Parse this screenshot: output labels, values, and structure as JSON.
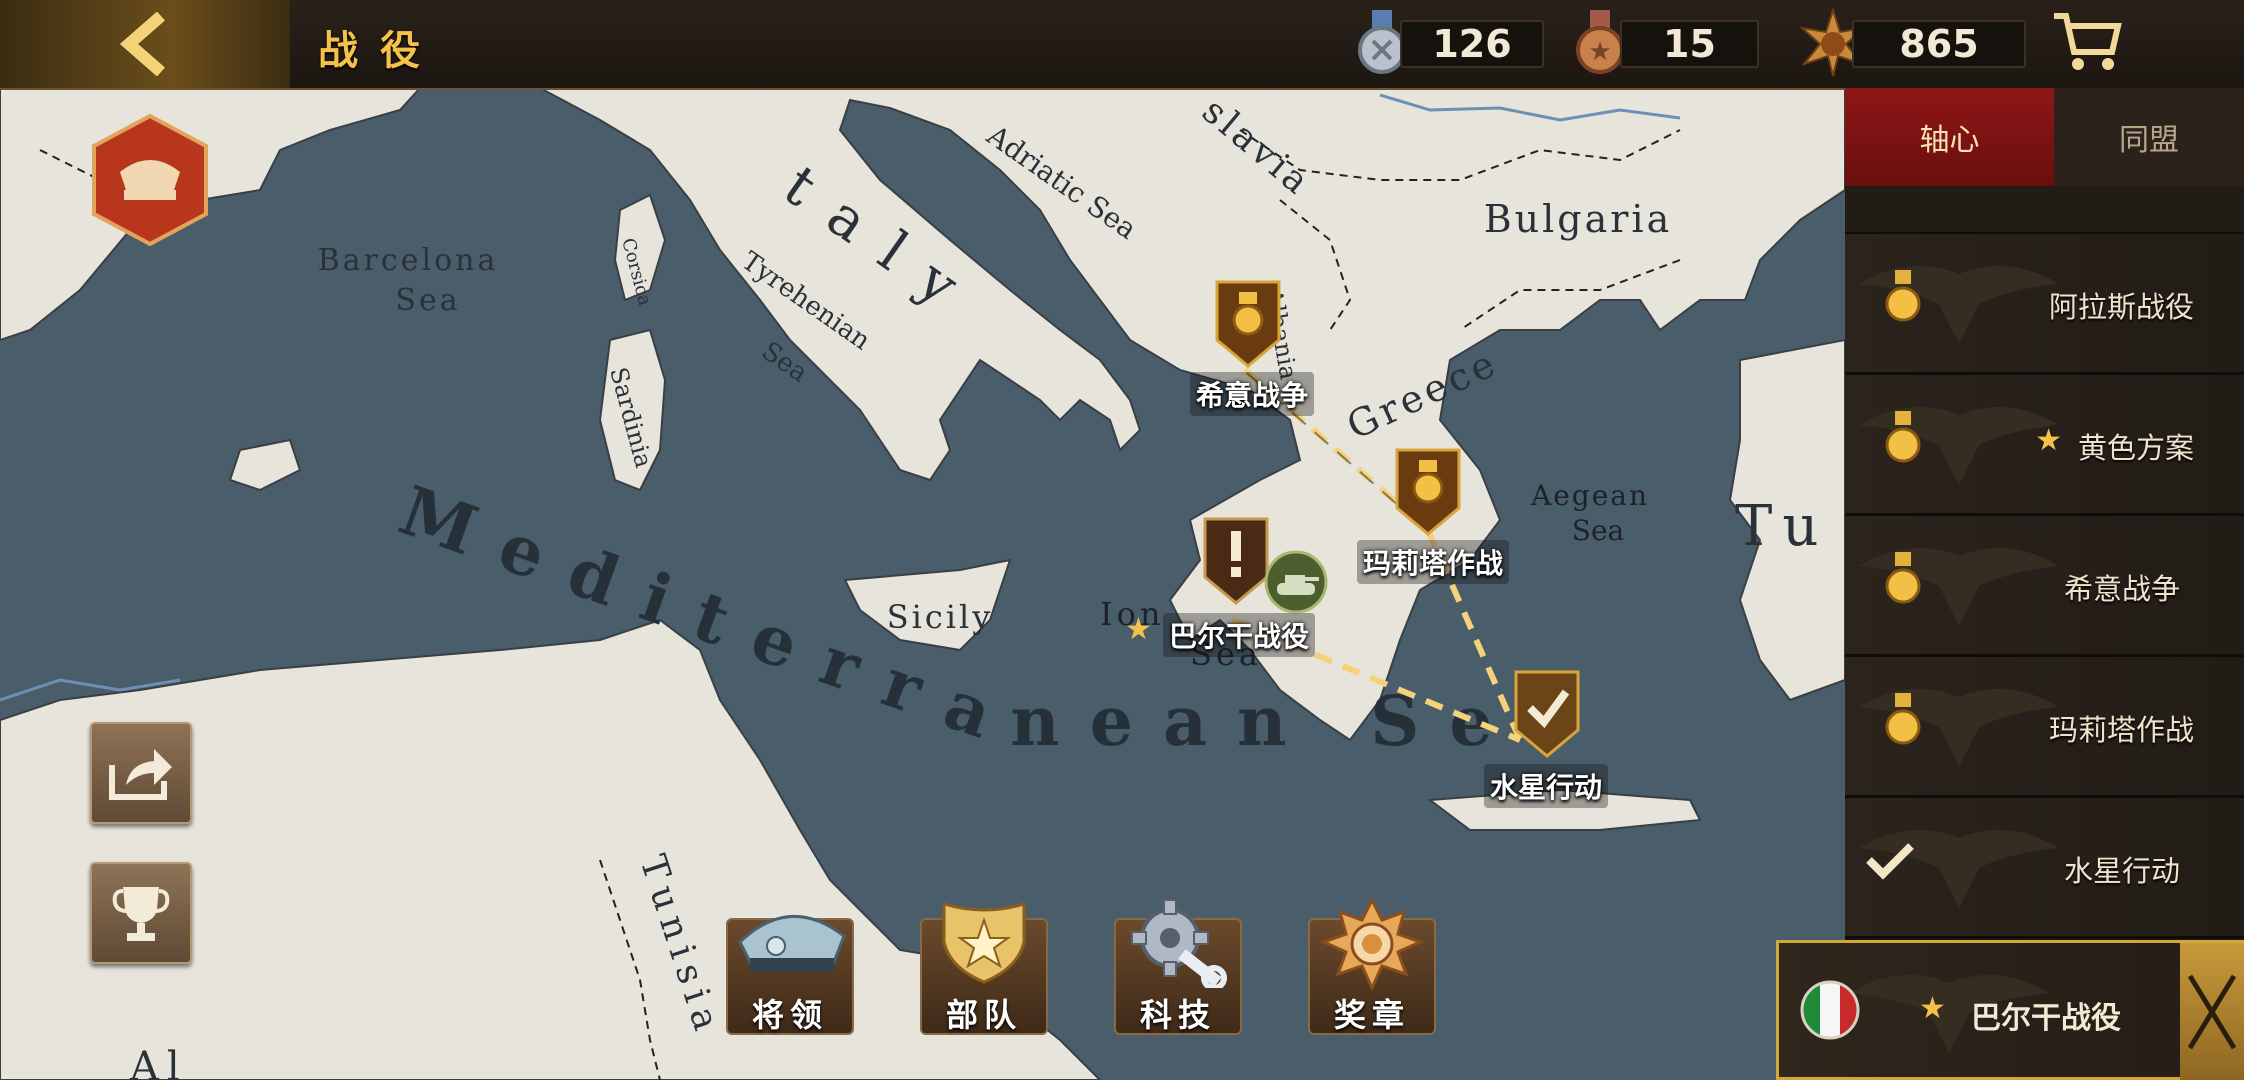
{
  "header": {
    "title": "战役",
    "back_icon": "chevron-left-icon",
    "resources": [
      {
        "name": "silver-medal-icon",
        "value": "126"
      },
      {
        "name": "bronze-medal-icon",
        "value": "15"
      },
      {
        "name": "star-badge-icon",
        "value": "865"
      }
    ],
    "shop_icon": "shopping-cart-icon"
  },
  "map": {
    "labels": {
      "barcelona": "Barcelona\nSea",
      "corsica": "Corsica",
      "sardinia": "Sardinia",
      "tyrrhenian": "Tyrehenian\nSea",
      "italy": "Italy",
      "adriatic": "Adriatic Sea",
      "yugoslavia": "Yugoslavia",
      "albania": "Albania",
      "bulgaria": "Bulgaria",
      "greece": "Greece",
      "aegean": "Aegean\nSea",
      "turkey": "Tu",
      "mediterranean": "Mediterranean Sea",
      "sicily": "Sicily",
      "ionian": "Ionian\nSea",
      "tunisia": "Tunisia",
      "al": "Al"
    },
    "nodes": [
      {
        "id": "greco-italian",
        "label": "希意战争",
        "state": "medal"
      },
      {
        "id": "marita",
        "label": "玛莉塔作战",
        "state": "medal"
      },
      {
        "id": "balkan",
        "label": "巴尔干战役",
        "state": "alert",
        "starred": true
      },
      {
        "id": "mercury",
        "label": "水星行动",
        "state": "completed"
      }
    ]
  },
  "left_buttons": {
    "general_badge_icon": "general-cap-badge-icon",
    "share_icon": "share-icon",
    "trophy_icon": "trophy-icon"
  },
  "bottom_nav": [
    {
      "label": "将领",
      "icon": "officer-cap-icon"
    },
    {
      "label": "部队",
      "icon": "army-star-shield-icon"
    },
    {
      "label": "科技",
      "icon": "gear-wrench-icon"
    },
    {
      "label": "奖章",
      "icon": "medal-icon"
    }
  ],
  "sidebar": {
    "tabs": [
      {
        "label": "轴心",
        "active": true
      },
      {
        "label": "同盟",
        "active": false
      }
    ],
    "campaigns": [
      {
        "label": "阿拉斯战役",
        "status": "medal",
        "starred": false
      },
      {
        "label": "黄色方案",
        "status": "medal",
        "starred": true
      },
      {
        "label": "希意战争",
        "status": "medal",
        "starred": false
      },
      {
        "label": "玛莉塔作战",
        "status": "medal",
        "starred": false
      },
      {
        "label": "水星行动",
        "status": "completed",
        "starred": false
      }
    ],
    "selected": {
      "label": "巴尔干战役",
      "starred": true,
      "flag": "italy-flag-icon"
    }
  },
  "colors": {
    "sea": "#4a5d6b",
    "land": "#e8e5dd",
    "accent_gold": "#f4c24a",
    "axis_red": "#8e1717"
  }
}
